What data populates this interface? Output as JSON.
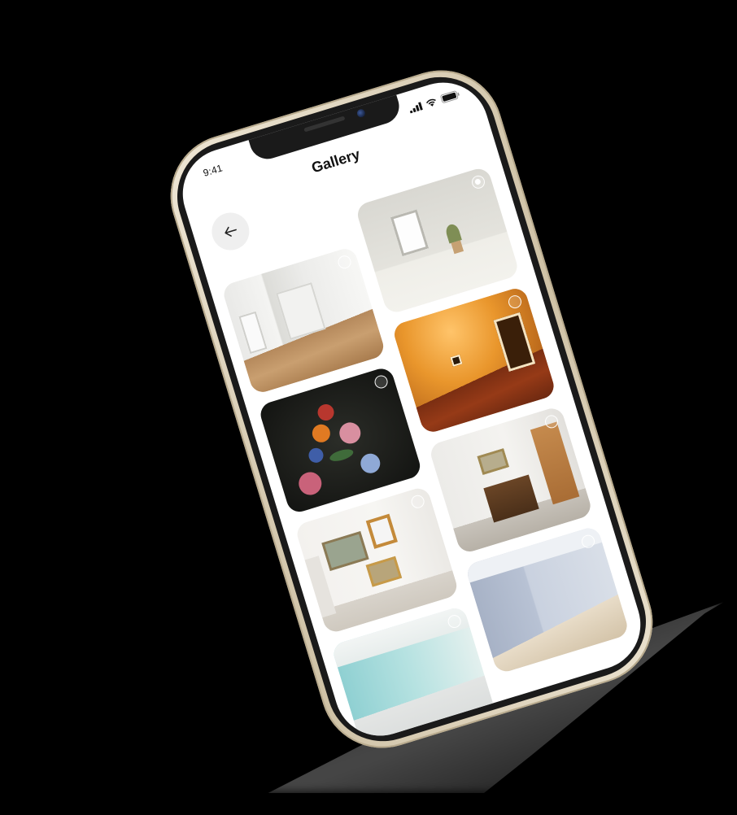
{
  "status_bar": {
    "time": "9:41",
    "signal_icon": "cellular-signal-icon",
    "wifi_icon": "wifi-icon",
    "battery_icon": "battery-icon"
  },
  "header": {
    "title": "Gallery",
    "back_icon": "arrow-left-icon"
  },
  "gallery": {
    "photos": [
      {
        "subject": "white-room",
        "selected": false
      },
      {
        "subject": "bright-room",
        "selected": true
      },
      {
        "subject": "orange-room",
        "selected": false
      },
      {
        "subject": "flowers-painting",
        "selected": false
      },
      {
        "subject": "hallway",
        "selected": false
      },
      {
        "subject": "gallery-wall",
        "selected": false
      },
      {
        "subject": "blue-room",
        "selected": false
      },
      {
        "subject": "aqua-room",
        "selected": false
      }
    ]
  },
  "colors": {
    "phone_frame": "#d7cbb2",
    "screen_background": "#ffffff",
    "back_button_background": "#efefef"
  }
}
